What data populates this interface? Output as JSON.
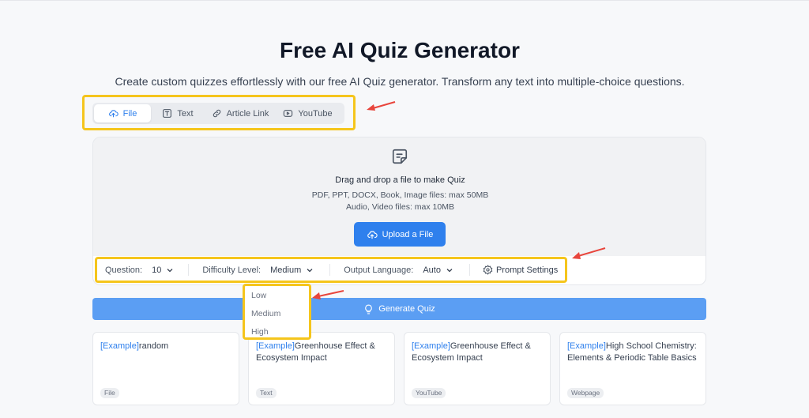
{
  "page": {
    "title": "Free AI Quiz Generator",
    "subtitle": "Create custom quizzes effortlessly with our free AI Quiz generator. Transform any text into multiple-choice questions."
  },
  "tabs": [
    {
      "label": "File",
      "icon": "cloud-upload-icon",
      "active": true
    },
    {
      "label": "Text",
      "icon": "text-icon",
      "active": false
    },
    {
      "label": "Article Link",
      "icon": "link-icon",
      "active": false
    },
    {
      "label": "YouTube",
      "icon": "youtube-icon",
      "active": false
    }
  ],
  "upload": {
    "title": "Drag and drop a file to make Quiz",
    "line1": "PDF, PPT, DOCX, Book, Image files: max 50MB",
    "line2": "Audio, Video files: max 10MB",
    "button": "Upload a File"
  },
  "settings": {
    "question_label": "Question:",
    "question_value": "10",
    "difficulty_label": "Difficulty Level:",
    "difficulty_value": "Medium",
    "language_label": "Output Language:",
    "language_value": "Auto",
    "prompt_label": "Prompt Settings"
  },
  "difficulty_options": [
    "Low",
    "Medium",
    "High"
  ],
  "generate": {
    "label": "Generate Quiz"
  },
  "examples": [
    {
      "tag": "[Example]",
      "title": "random",
      "badge": "File"
    },
    {
      "tag": "[Example]",
      "title": "Greenhouse Effect & Ecosystem Impact",
      "badge": "Text"
    },
    {
      "tag": "[Example]",
      "title": "Greenhouse Effect & Ecosystem Impact",
      "badge": "YouTube"
    },
    {
      "tag": "[Example]",
      "title": "High School Chemistry: Elements & Periodic Table Basics",
      "badge": "Webpage"
    }
  ],
  "colors": {
    "accent": "#2f80ed",
    "generate": "#5b9ef3",
    "highlight": "#f5c51c",
    "arrow": "#e8453c"
  }
}
